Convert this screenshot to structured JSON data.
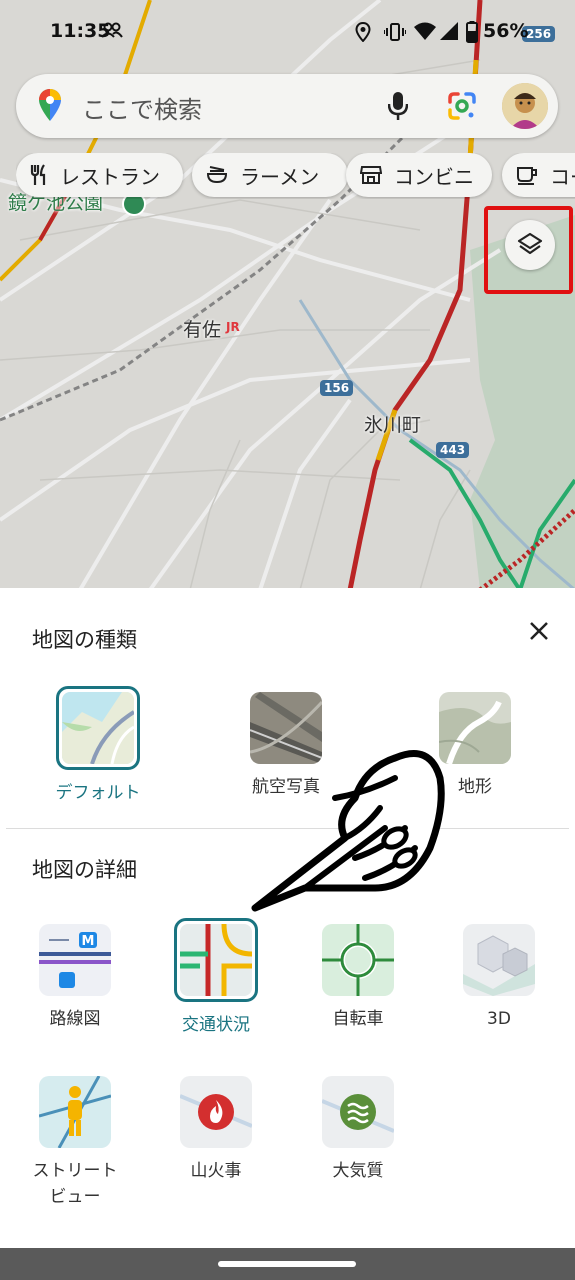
{
  "status_bar": {
    "time": "11:35",
    "battery": "56%"
  },
  "search": {
    "placeholder": "ここで検索"
  },
  "chips": [
    {
      "label": "レストラン",
      "icon": "fork-knife-icon"
    },
    {
      "label": "ラーメン",
      "icon": "ramen-bowl-icon"
    },
    {
      "label": "コンビニ",
      "icon": "store-icon"
    },
    {
      "label": "コー",
      "icon": "coffee-icon"
    }
  ],
  "map": {
    "labels": {
      "park": "鏡ケ池公園",
      "station": "有佐",
      "town": "氷川町"
    },
    "route_numbers": [
      "256",
      "156",
      "443"
    ]
  },
  "sheet": {
    "map_type_title": "地図の種類",
    "map_types": [
      {
        "label": "デフォルト",
        "selected": true
      },
      {
        "label": "航空写真",
        "selected": false
      },
      {
        "label": "地形",
        "selected": false
      }
    ],
    "details_title": "地図の詳細",
    "details": [
      {
        "label": "路線図",
        "selected": false
      },
      {
        "label": "交通状況",
        "selected": true
      },
      {
        "label": "自転車",
        "selected": false
      },
      {
        "label": "3D",
        "selected": false
      },
      {
        "label": "ストリート\nビュー",
        "selected": false
      },
      {
        "label": "山火事",
        "selected": false
      },
      {
        "label": "大気質",
        "selected": false
      }
    ]
  },
  "colors": {
    "accent": "#1a7481",
    "highlight": "#e01010",
    "traffic_red": "#c62828",
    "traffic_yellow": "#f2b600",
    "traffic_green": "#2bb673"
  }
}
